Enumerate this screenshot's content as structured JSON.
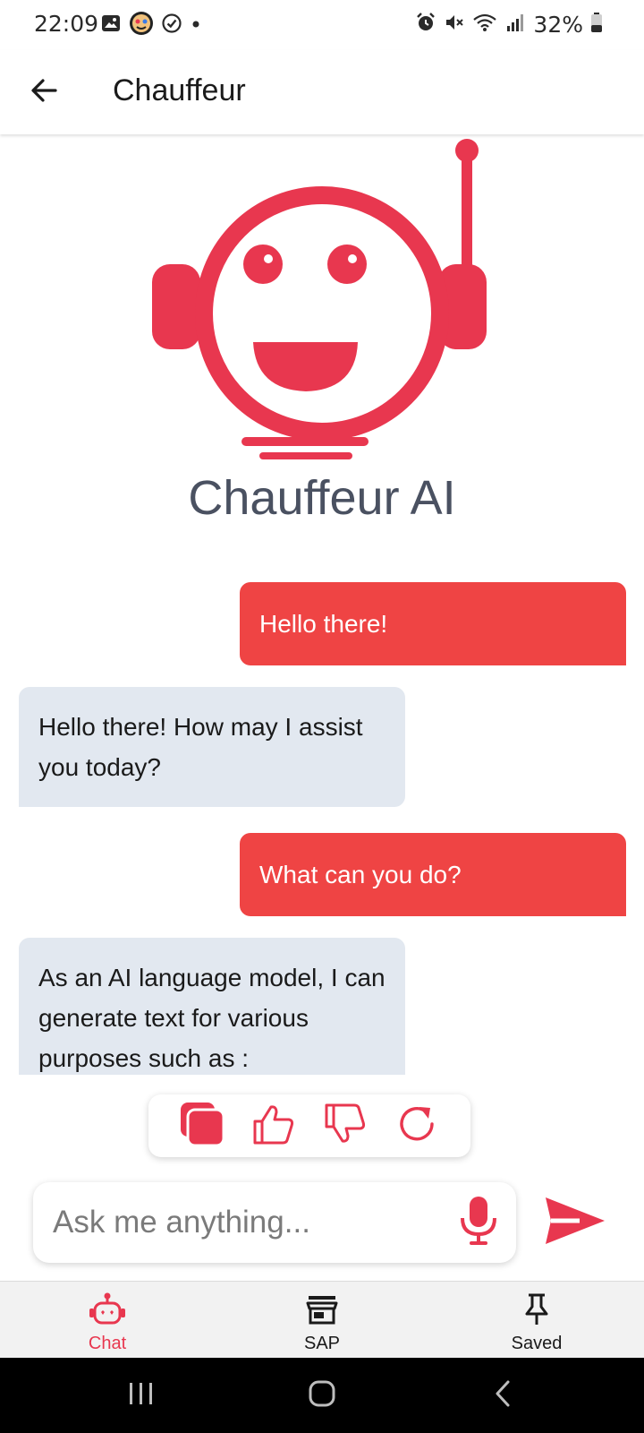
{
  "status_bar": {
    "time": "22:09",
    "battery": "32%",
    "left_icons": [
      "image-icon",
      "app-avatar-icon",
      "check-circle-icon",
      "dot-icon"
    ],
    "right_icons": [
      "alarm-icon",
      "mute-icon",
      "wifi-icon",
      "signal-icon",
      "battery-icon"
    ]
  },
  "app_bar": {
    "title": "Chauffeur"
  },
  "brand": {
    "name": "Chauffeur AI",
    "accent": "#e8374f"
  },
  "messages": [
    {
      "role": "user",
      "text": "Hello there!"
    },
    {
      "role": "bot",
      "text": "Hello there! How may I assist you today?"
    },
    {
      "role": "user",
      "text": "What can you do?"
    },
    {
      "role": "bot",
      "text": "As an AI language model, I can generate text for various purposes such as :"
    }
  ],
  "actions": [
    "copy-icon",
    "thumbs-up-icon",
    "thumbs-down-icon",
    "refresh-icon"
  ],
  "input": {
    "placeholder": "Ask me anything...",
    "value": ""
  },
  "bottom_nav": {
    "items": [
      {
        "label": "Chat",
        "icon": "robot-icon",
        "active": true
      },
      {
        "label": "SAP",
        "icon": "store-icon",
        "active": false
      },
      {
        "label": "Saved",
        "icon": "pin-icon",
        "active": false
      }
    ]
  },
  "colors": {
    "user_bubble": "#ef4444",
    "bot_bubble": "#e2e8f0",
    "nav_active": "#e8374f"
  }
}
